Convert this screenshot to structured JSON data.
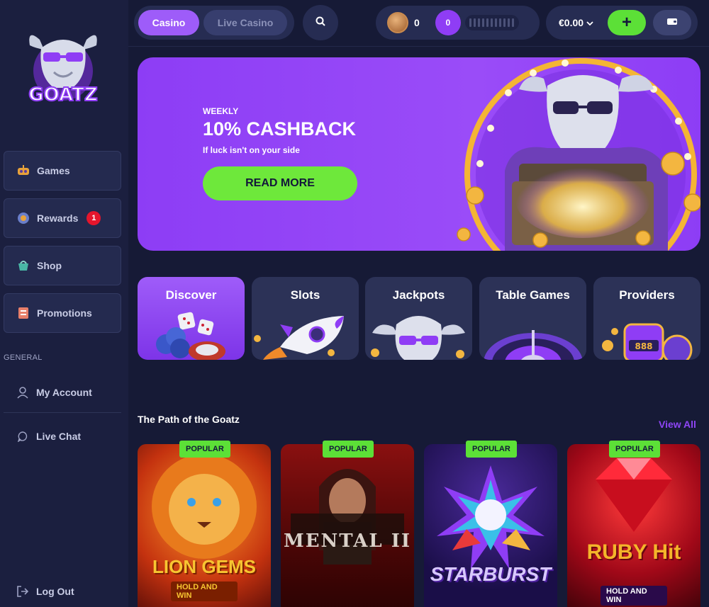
{
  "sidebar": {
    "logo_text": "GOATZ",
    "nav": [
      {
        "label": "Games",
        "icon": "games-icon"
      },
      {
        "label": "Rewards",
        "icon": "rewards-icon",
        "badge": "1"
      },
      {
        "label": "Shop",
        "icon": "shop-icon"
      },
      {
        "label": "Promotions",
        "icon": "promotions-icon"
      }
    ],
    "section_label": "GENERAL",
    "links": [
      {
        "label": "My Account",
        "icon": "user-icon"
      },
      {
        "label": "Live Chat",
        "icon": "chat-icon"
      },
      {
        "label": "Log Out",
        "icon": "logout-icon"
      }
    ]
  },
  "topbar": {
    "tabs": [
      {
        "label": "Casino",
        "active": true
      },
      {
        "label": "Live Casino",
        "active": false
      }
    ],
    "coins": "0",
    "level": "0",
    "balance": "€0.00",
    "plus_label": "+"
  },
  "banner": {
    "kicker": "WEEKLY",
    "headline": "10% CASHBACK",
    "subtitle": "If luck isn't on your side",
    "button": "READ MORE"
  },
  "categories": [
    {
      "label": "Discover",
      "active": true
    },
    {
      "label": "Slots",
      "active": false
    },
    {
      "label": "Jackpots",
      "active": false
    },
    {
      "label": "Table Games",
      "active": false
    },
    {
      "label": "Providers",
      "active": false
    }
  ],
  "path_section": {
    "title": "The Path of the Goatz",
    "view_all": "View All",
    "games": [
      {
        "badge": "POPULAR",
        "title": "LION GEMS",
        "subtitle": "HOLD AND WIN"
      },
      {
        "badge": "POPULAR",
        "title": "MENTAL II",
        "subtitle": ""
      },
      {
        "badge": "POPULAR",
        "title": "STARBURST",
        "subtitle": ""
      },
      {
        "badge": "POPULAR",
        "title": "RUBY Hit",
        "subtitle": "HOLD AND WIN"
      }
    ]
  },
  "colors": {
    "accent_purple": "#9e5cf9",
    "accent_green": "#5ce037",
    "background": "#161a36",
    "sidebar": "#1b1f3f",
    "badge_red": "#e5152c"
  }
}
